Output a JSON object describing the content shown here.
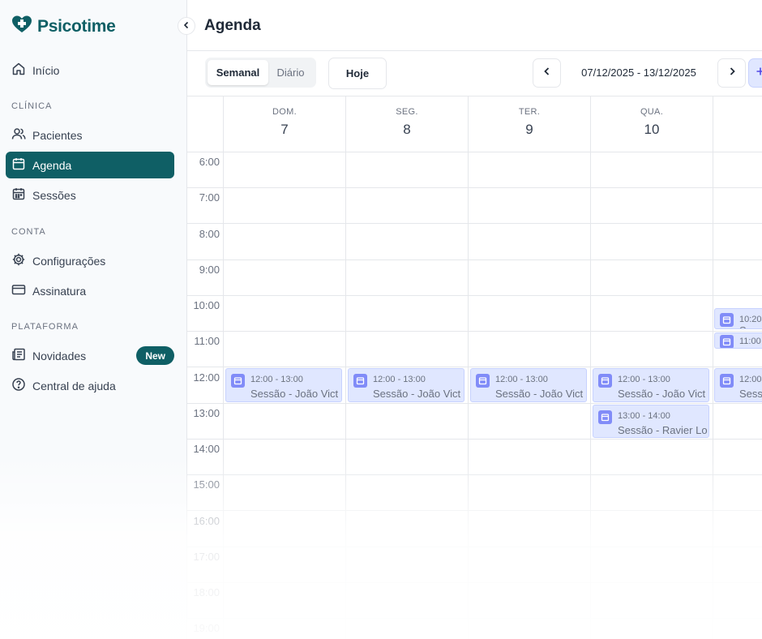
{
  "app": {
    "name": "Psicotime"
  },
  "sidebar": {
    "home": "Início",
    "sections": {
      "clinica": "CLÍNICA",
      "conta": "CONTA",
      "plataforma": "PLATAFORMA"
    },
    "items": {
      "pacientes": "Pacientes",
      "agenda": "Agenda",
      "sessoes": "Sessões",
      "configuracoes": "Configurações",
      "assinatura": "Assinatura",
      "novidades": "Novidades",
      "novidades_badge": "New",
      "ajuda": "Central de ajuda"
    }
  },
  "header": {
    "title": "Agenda"
  },
  "toolbar": {
    "view_weekly": "Semanal",
    "view_daily": "Diário",
    "today": "Hoje",
    "date_range": "07/12/2025 - 13/12/2025"
  },
  "calendar": {
    "days": [
      {
        "name": "DOM.",
        "num": "7"
      },
      {
        "name": "SEG.",
        "num": "8"
      },
      {
        "name": "TER.",
        "num": "9"
      },
      {
        "name": "QUA.",
        "num": "10"
      }
    ],
    "hours": [
      "6:00",
      "7:00",
      "8:00",
      "9:00",
      "10:00",
      "11:00",
      "12:00",
      "13:00",
      "14:00",
      "15:00",
      "16:00",
      "17:00",
      "18:00",
      "19:00"
    ],
    "events": [
      {
        "time": "12:00 - 13:00",
        "title": "Sessão - João Vict"
      },
      {
        "time": "12:00 - 13:00",
        "title": "Sessão - João Vict"
      },
      {
        "time": "12:00 - 13:00",
        "title": "Sessão - João Vict"
      },
      {
        "time": "12:00 - 13:00",
        "title": "Sessão - João Vict"
      },
      {
        "time": "13:00 - 14:00",
        "title": "Sessão - Ravier Lo"
      },
      {
        "time": "10:20",
        "title": "S"
      },
      {
        "time": "11:00",
        "title": ""
      },
      {
        "time": "12:00",
        "title": "Sess"
      }
    ]
  },
  "colors": {
    "brand": "#0f5f65",
    "event_bg": "#e0e7ff",
    "event_icon": "#818cf8"
  }
}
